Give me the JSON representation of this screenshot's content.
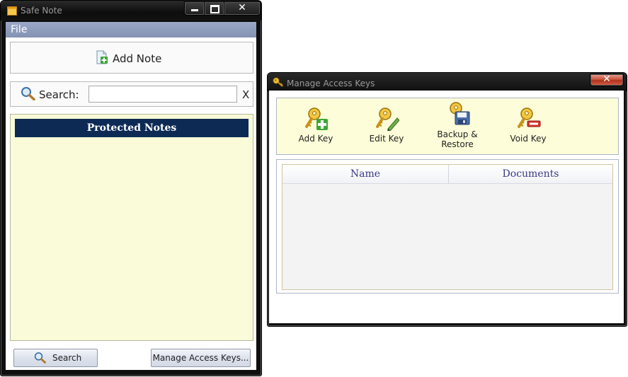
{
  "main_window": {
    "title": "Safe Note",
    "menu": {
      "file": "File"
    },
    "add_note_label": "Add Note",
    "search": {
      "label": "Search:",
      "value": "",
      "placeholder": "",
      "clear": "X"
    },
    "notes_header": "Protected Notes",
    "buttons": {
      "search": "Search",
      "manage_keys": "Manage Access Keys..."
    }
  },
  "keys_window": {
    "title": "Manage Access Keys",
    "toolbar": {
      "add_key": "Add Key",
      "edit_key": "Edit Key",
      "backup_line1": "Backup &",
      "backup_line2": "Restore",
      "void_key": "Void Key"
    },
    "grid": {
      "columns": [
        "Name",
        "Documents"
      ]
    }
  },
  "icons": {
    "app": "note-icon",
    "add_note": "document-add-icon",
    "search": "magnifier-icon",
    "add_key": "key-plus-icon",
    "edit_key": "key-pencil-icon",
    "backup": "key-disk-icon",
    "void_key": "key-minus-icon",
    "keys_window": "key-icon"
  },
  "colors": {
    "notes_header_bg": "#0d2a55",
    "notes_bg": "#fafbd9",
    "menubar": "#8f9cbc",
    "close_button": "#c9553f",
    "grid_header_text": "#3a3a86"
  }
}
